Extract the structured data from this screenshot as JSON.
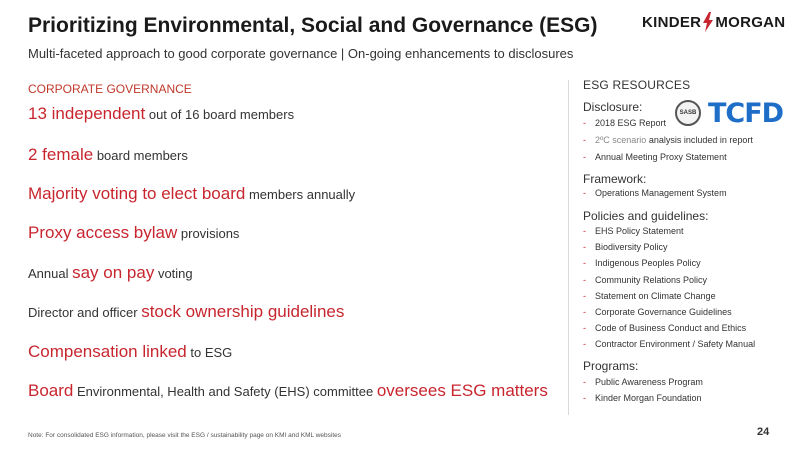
{
  "header": {
    "title": "Prioritizing Environmental, Social and Governance (ESG)",
    "subtitle": "Multi-faceted approach to good corporate governance | On-going enhancements to disclosures",
    "logo_left": "KINDER",
    "logo_right": "MORGAN"
  },
  "governance": {
    "heading": "CORPORATE GOVERNANCE",
    "items": [
      {
        "pre": "",
        "em": "13 independent",
        "post": " out of 16 board members"
      },
      {
        "pre": "",
        "em": "2 female",
        "post": " board members"
      },
      {
        "pre": "",
        "em": "Majority voting to elect board",
        "post": " members annually"
      },
      {
        "pre": "",
        "em": "Proxy access bylaw",
        "post": " provisions"
      },
      {
        "pre": "Annual ",
        "em": "say on pay",
        "post": " voting"
      },
      {
        "pre": "Director and officer ",
        "em": "stock ownership guidelines",
        "post": ""
      },
      {
        "pre": "",
        "em": "Compensation linked",
        "post": " to ESG"
      },
      {
        "pre": "",
        "em": "Board",
        "post": " Environmental, Health and Safety (EHS) committee ",
        "em2": "oversees ESG matters"
      }
    ]
  },
  "resources": {
    "heading": "ESG RESOURCES",
    "disclosure": {
      "label": "Disclosure:",
      "items": [
        "2018 ESG Report",
        "2ºC scenario",
        " analysis included in report",
        "Annual Meeting Proxy Statement"
      ]
    },
    "badges": {
      "sasb": "SASB",
      "tcfd": "TCFD"
    },
    "framework": {
      "label": "Framework:",
      "items": [
        "Operations Management System"
      ]
    },
    "policies": {
      "label": "Policies and guidelines:",
      "items": [
        "EHS Policy Statement",
        "Biodiversity Policy",
        "Indigenous Peoples Policy",
        "Community Relations Policy",
        "Statement on Climate Change",
        "Corporate Governance Guidelines",
        "Code of Business Conduct and Ethics",
        "Contractor Environment / Safety Manual"
      ]
    },
    "programs": {
      "label": "Programs:",
      "items": [
        "Public Awareness Program",
        "Kinder Morgan Foundation"
      ]
    }
  },
  "footer": {
    "note": "Note:  For consolidated ESG information, please visit the ESG / sustainability page on KMI and KML websites",
    "page": "24"
  },
  "colors": {
    "accent": "#c8262f",
    "tcfd": "#1e6ec8",
    "text": "#333333"
  }
}
